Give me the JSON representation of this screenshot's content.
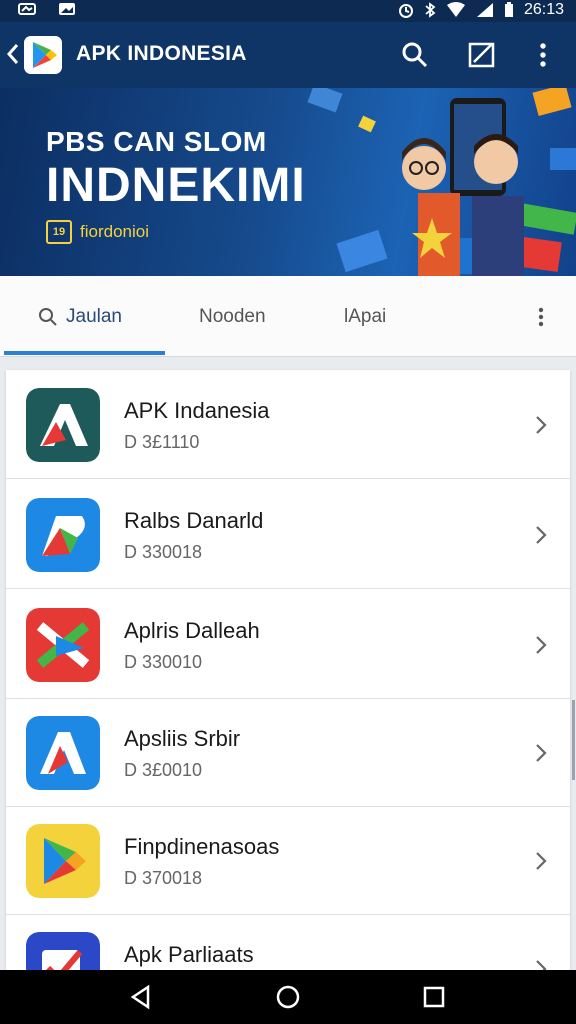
{
  "status_bar": {
    "time": "26:13",
    "icons": [
      "notification-icon",
      "image-icon",
      "alarm-icon",
      "bluetooth-icon",
      "wifi-icon",
      "signal-icon",
      "battery-icon"
    ]
  },
  "app_bar": {
    "title": "APK INDONESIA",
    "icons": [
      "back-arrow-icon",
      "play-store-logo",
      "search-icon",
      "edit-icon",
      "more-vert-icon"
    ]
  },
  "banner": {
    "headline": "PBS CAN SLOM",
    "title": "INDNEKIMI",
    "tag_badge": "19",
    "tag": "fiordonioi",
    "colors": {
      "background": "#0f3566",
      "accent": "#f4d23c"
    }
  },
  "tabs": {
    "items": [
      {
        "label": "Jaulan",
        "active": true
      },
      {
        "label": "Nooden",
        "active": false
      },
      {
        "label": "lApai",
        "active": false
      }
    ],
    "accent": "#2d7fd4"
  },
  "apps": [
    {
      "name": "APK Indanesia",
      "sub": "D 3£1110",
      "icon": "apk-a-logo-icon",
      "color": "#1f5a5a"
    },
    {
      "name": "Ralbs Danarld",
      "sub": "D 330018",
      "icon": "red-a-logo-icon",
      "color": "#1e88e5"
    },
    {
      "name": "Aplris Dalleah",
      "sub": "D 330010",
      "icon": "colorful-x-logo-icon",
      "color": "#e53935"
    },
    {
      "name": "Apsliis Srbir",
      "sub": "D 3£0010",
      "icon": "red-a-logo-icon",
      "color": "#1e88e5"
    },
    {
      "name": "Finpdinenasoas",
      "sub": "D 370018",
      "icon": "play-triangle-icon",
      "color": "#f4d23c"
    },
    {
      "name": "Apk Parliaats",
      "sub": "",
      "icon": "checkbox-icon",
      "color": "#2a48c8"
    }
  ],
  "nav": {
    "icons": [
      "back-triangle-icon",
      "home-circle-icon",
      "recents-square-icon"
    ]
  }
}
